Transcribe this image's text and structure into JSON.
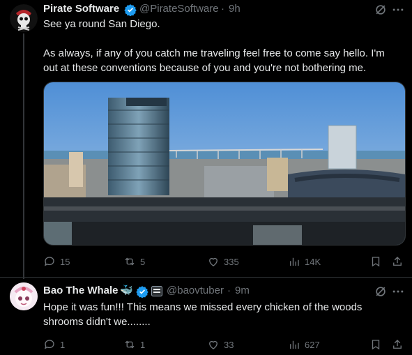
{
  "tweet1": {
    "author_name": "Pirate Software",
    "handle": "@PirateSoftware",
    "separator": "·",
    "time": "9h",
    "line1": "See ya round San Diego.",
    "line2": "As always, if any of you catch me traveling feel free to come say hello. I'm",
    "line3": "out at these conventions because of you and you're not bothering me.",
    "stats": {
      "replies": "15",
      "reposts": "5",
      "likes": "335",
      "views": "14K"
    }
  },
  "tweet2": {
    "author_name": "Bao The Whale",
    "emoji": "🐳",
    "handle": "@baovtuber",
    "separator": "·",
    "time": "9m",
    "line1": "Hope it was fun!!! This means we missed every chicken of the woods",
    "line2": "shrooms didn't we........",
    "stats": {
      "replies": "1",
      "reposts": "1",
      "likes": "33",
      "views": "627"
    }
  },
  "colors": {
    "background": "#000000",
    "text": "#e7e9ea",
    "muted": "#71767b",
    "verified": "#1d9bf0"
  },
  "icons": [
    "skull-avatar",
    "verified-badge-icon",
    "grok-icon",
    "more-icon",
    "reply-icon",
    "repost-icon",
    "like-icon",
    "views-icon",
    "bookmark-icon",
    "share-icon",
    "subscriber-badge-icon",
    "whale-emoji"
  ]
}
